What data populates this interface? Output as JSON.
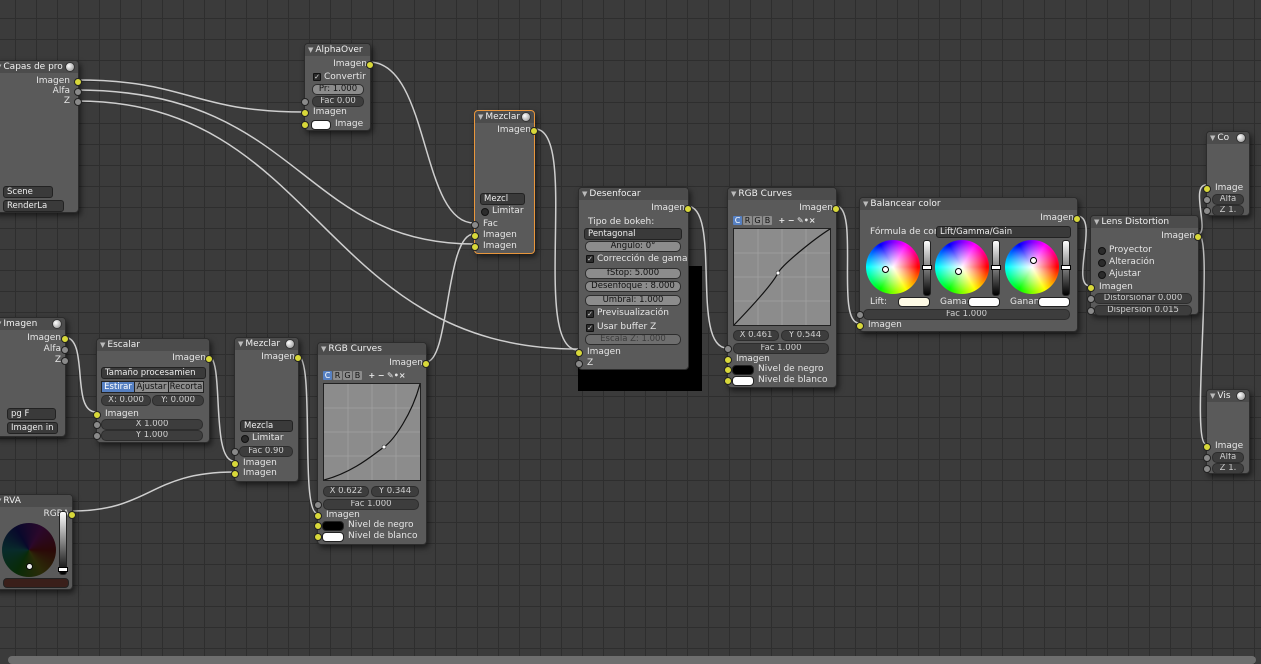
{
  "nodes": {
    "render_layers": {
      "title": "Capas de pro",
      "out": [
        "Imagen",
        "Alfa",
        "Z"
      ],
      "scene": "Scene",
      "layer": "RenderLa"
    },
    "alpha_over": {
      "title": "AlphaOver",
      "out": "Imagen",
      "convert": "Convertir",
      "pr": "Pr: 1.000",
      "fac": "Fac 0.00",
      "in1": "Imagen",
      "in2": "Image"
    },
    "mix_top": {
      "title": "Mezclar",
      "out": "Imagen",
      "mode": "Mezcl",
      "clamp": "Limitar",
      "in": [
        "Fac",
        "Imagen",
        "Imagen"
      ]
    },
    "defocus": {
      "title": "Desenfocar",
      "out": "Imagen",
      "bokeh_label": "Tipo de bokeh:",
      "bokeh": "Pentagonal",
      "angle": "Ángulo: 0°",
      "gamma": "Corrección de gama",
      "fstop": "fStop: 5.000",
      "maxblur": "Desenfoque : 8.000",
      "threshold": "Umbral: 1.000",
      "preview": "Previsualización",
      "zbuffer": "Usar buffer Z",
      "zscale": "Escala Z: 1.000",
      "in": [
        "Imagen",
        "Z"
      ]
    },
    "curves_right": {
      "title": "RGB Curves",
      "out": "Imagen",
      "x": "X 0.461",
      "y": "Y 0.544",
      "fac": "Fac 1.000",
      "in": [
        "Imagen",
        "Nivel de negro",
        "Nivel de blanco"
      ]
    },
    "color_balance": {
      "title": "Balancear color",
      "out": "Imagen",
      "formula_label": "Fórmula de cor",
      "formula": "Lift/Gamma/Gain",
      "lift": "Lift:",
      "gamma": "Gama:",
      "gain": "Ganan",
      "fac": "Fac 1.000",
      "in": "Imagen"
    },
    "lens": {
      "title": "Lens Distortion",
      "out": "Imagen",
      "opts": [
        "Proyector",
        "Alteración",
        "Ajustar"
      ],
      "in": "Imagen",
      "distort": "Distorsionar 0.000",
      "disp": "Dispersión 0.015"
    },
    "composite": {
      "title": "Co",
      "in": [
        "Image",
        "Alfa",
        "Z 1."
      ]
    },
    "viewer": {
      "title": "Vis",
      "in": [
        "Image",
        "Alfa",
        "Z 1."
      ]
    },
    "image": {
      "title": "Imagen",
      "out": [
        "Imagen",
        "Alfa",
        "Z"
      ],
      "file": "pg",
      "flag": "F",
      "source": "Imagen in"
    },
    "scale": {
      "title": "Escalar",
      "out": "Imagen",
      "space": "Tamaño procesamien",
      "b1": "Estirar",
      "b2": "Ajustar",
      "b3": "Recorta",
      "x": "X: 0.000",
      "y": "Y: 0.000",
      "in": "Imagen",
      "sx": "X 1.000",
      "sy": "Y 1.000"
    },
    "mix_bottom": {
      "title": "Mezclar",
      "out": "Imagen",
      "mode": "Mezcla",
      "clamp": "Limitar",
      "fac": "Fac 0.90",
      "in": [
        "Imagen",
        "Imagen"
      ]
    },
    "curves_left": {
      "title": "RGB Curves",
      "out": "Imagen",
      "x": "X 0.622",
      "y": "Y 0.344",
      "fac": "Fac 1.000",
      "in": [
        "Imagen",
        "Nivel de negro",
        "Nivel de blanco"
      ]
    },
    "rgb": {
      "title": "RVA",
      "out": "RGBA"
    }
  },
  "curve_tools": {
    "c": "C",
    "r": "R",
    "g": "G",
    "b": "B",
    "plus": "+",
    "minus": "−"
  },
  "colors": {
    "socket_color": "#d8d83a",
    "socket_value": "#8a8a8a",
    "selected_outline": "#e8963c",
    "link": "#d9d9d9"
  }
}
